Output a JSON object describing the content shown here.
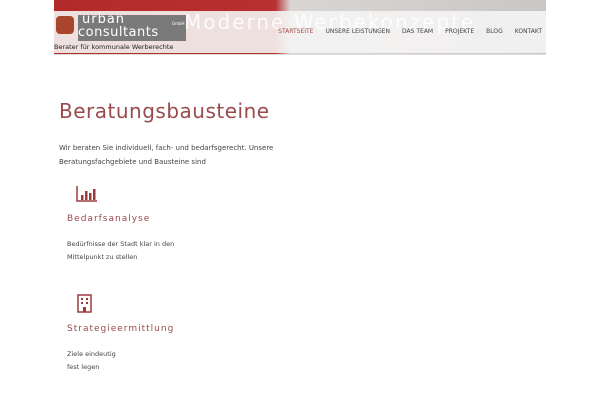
{
  "hero": {
    "title": "Moderne Werbekonzepte"
  },
  "logo": {
    "line1": "urban",
    "line2": "consultants",
    "gmbh": "GmbH",
    "tagline": "Berater für kommunale Werberechte"
  },
  "nav": [
    {
      "label": "STARTSEITE",
      "active": true
    },
    {
      "label": "UNSERE LEISTUNGEN"
    },
    {
      "label": "DAS TEAM"
    },
    {
      "label": "PROJEKTE"
    },
    {
      "label": "BLOG"
    },
    {
      "label": "KONTAKT"
    }
  ],
  "main": {
    "title": "Beratungsbausteine",
    "intro": "Wir beraten Sie individuell, fach- und bedarfsgerecht. Unsere Beratungsfachgebiete und Bausteine sind",
    "blocks": [
      {
        "icon": "bar-chart-icon",
        "title": "Bedarfsanalyse",
        "lines": [
          "Bedürfnisse der Stadt klar in den",
          "Mittelpunkt zu stellen"
        ]
      },
      {
        "icon": "building-icon",
        "title": "Strategieermittlung",
        "lines": [
          "Ziele eindeutig",
          "fest legen"
        ]
      }
    ]
  },
  "colors": {
    "accent": "#9a4a4d"
  }
}
